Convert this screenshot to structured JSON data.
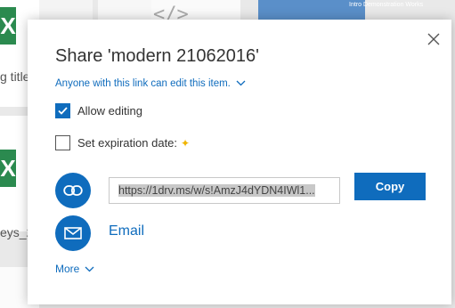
{
  "background": {
    "file_title_fragment_1": "g title",
    "file_title_fragment_2": "eys_2",
    "photo_caption": "Intro Demonstration Works"
  },
  "dialog": {
    "title": "Share 'modern 21062016'",
    "permission_text": "Anyone with this link can edit this item.",
    "allow_editing": {
      "label": "Allow editing",
      "checked": true
    },
    "expiration": {
      "label": "Set expiration date:",
      "checked": false,
      "badge": "✦"
    },
    "link": {
      "url": "https://1drv.ms/w/s!AmzJ4dYDN4IWl1..."
    },
    "copy_label": "Copy",
    "email_label": "Email",
    "more_label": "More"
  },
  "colors": {
    "accent": "#0f6cbd",
    "premium_badge": "#f0b400"
  },
  "icons": [
    "close-icon",
    "chevron-down-icon",
    "link-icon",
    "mail-icon"
  ]
}
